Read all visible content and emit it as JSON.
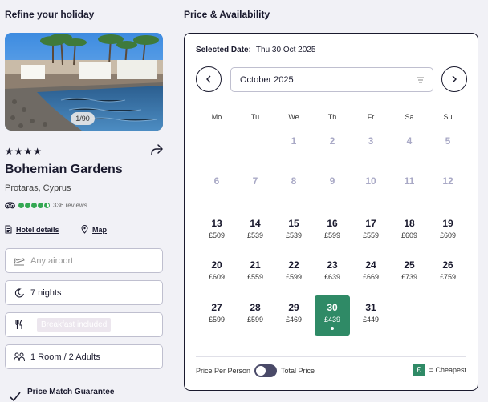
{
  "left": {
    "title": "Refine your holiday",
    "image_counter": "1/90",
    "stars": "★★★★",
    "hotel_name": "Bohemian Gardens",
    "location": "Protaras, Cyprus",
    "rating_score_of_5": 4.5,
    "reviews": "336 reviews",
    "links": {
      "hotel_details": "Hotel details",
      "map": "Map"
    },
    "fields": {
      "airport_placeholder": "Any airport",
      "nights": "7 nights",
      "board": "Breakfast included",
      "room": "1 Room / 2 Adults"
    },
    "price_match": "Price Match Guarantee"
  },
  "right": {
    "title": "Price & Availability",
    "selected_date_label": "Selected Date:",
    "selected_date": "Thu 30 Oct 2025",
    "month": "October 2025",
    "weekdays": [
      "Mo",
      "Tu",
      "We",
      "Th",
      "Fr",
      "Sa",
      "Su"
    ],
    "weeks": [
      [
        {
          "day": "",
          "price": "",
          "state": "empty"
        },
        {
          "day": "",
          "price": "",
          "state": "empty"
        },
        {
          "day": "1",
          "price": "",
          "state": "disabled"
        },
        {
          "day": "2",
          "price": "",
          "state": "disabled"
        },
        {
          "day": "3",
          "price": "",
          "state": "disabled"
        },
        {
          "day": "4",
          "price": "",
          "state": "disabled"
        },
        {
          "day": "5",
          "price": "",
          "state": "disabled"
        }
      ],
      [
        {
          "day": "6",
          "price": "",
          "state": "disabled"
        },
        {
          "day": "7",
          "price": "",
          "state": "disabled"
        },
        {
          "day": "8",
          "price": "",
          "state": "disabled"
        },
        {
          "day": "9",
          "price": "",
          "state": "disabled"
        },
        {
          "day": "10",
          "price": "",
          "state": "disabled"
        },
        {
          "day": "11",
          "price": "",
          "state": "disabled"
        },
        {
          "day": "12",
          "price": "",
          "state": "disabled"
        }
      ],
      [
        {
          "day": "13",
          "price": "£509",
          "state": "available"
        },
        {
          "day": "14",
          "price": "£539",
          "state": "available"
        },
        {
          "day": "15",
          "price": "£539",
          "state": "available"
        },
        {
          "day": "16",
          "price": "£599",
          "state": "available"
        },
        {
          "day": "17",
          "price": "£559",
          "state": "available"
        },
        {
          "day": "18",
          "price": "£609",
          "state": "available"
        },
        {
          "day": "19",
          "price": "£609",
          "state": "available"
        }
      ],
      [
        {
          "day": "20",
          "price": "£609",
          "state": "available"
        },
        {
          "day": "21",
          "price": "£559",
          "state": "available"
        },
        {
          "day": "22",
          "price": "£599",
          "state": "available"
        },
        {
          "day": "23",
          "price": "£639",
          "state": "available"
        },
        {
          "day": "24",
          "price": "£669",
          "state": "available"
        },
        {
          "day": "25",
          "price": "£739",
          "state": "available"
        },
        {
          "day": "26",
          "price": "£759",
          "state": "available"
        }
      ],
      [
        {
          "day": "27",
          "price": "£599",
          "state": "available"
        },
        {
          "day": "28",
          "price": "£599",
          "state": "available"
        },
        {
          "day": "29",
          "price": "£469",
          "state": "available"
        },
        {
          "day": "30",
          "price": "£439",
          "state": "selected"
        },
        {
          "day": "31",
          "price": "£449",
          "state": "available"
        },
        {
          "day": "",
          "price": "",
          "state": "empty"
        },
        {
          "day": "",
          "price": "",
          "state": "empty"
        }
      ]
    ],
    "toggle_left": "Price Per Person",
    "toggle_right": "Total Price",
    "legend_symbol": "£",
    "legend_text": "= Cheapest",
    "colors": {
      "accent": "#2f8a66",
      "border": "#1a1a2e",
      "disabled": "#a9a9c6"
    }
  }
}
